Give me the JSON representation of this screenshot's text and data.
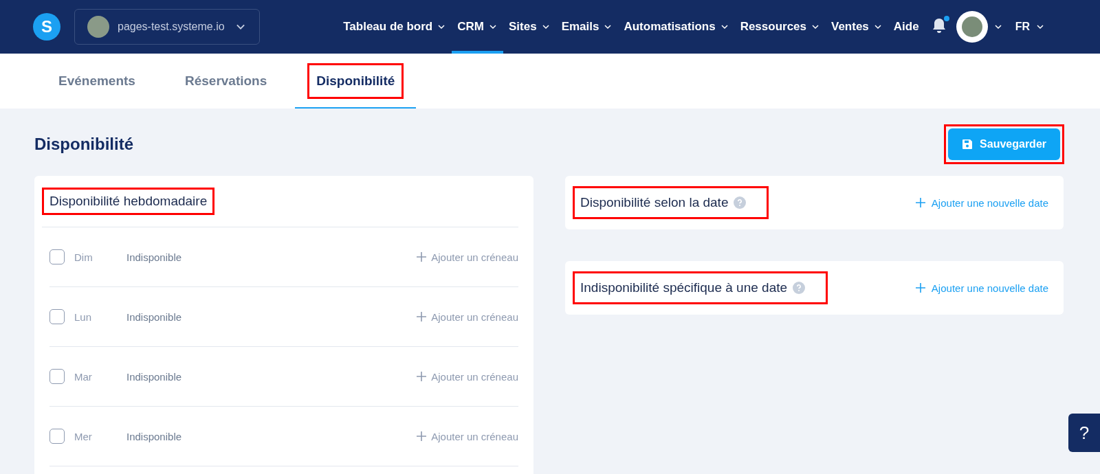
{
  "header": {
    "logo": "S",
    "site_selector": "pages-test.systeme.io",
    "nav": [
      {
        "label": "Tableau de bord",
        "dropdown": true,
        "selected": false
      },
      {
        "label": "CRM",
        "dropdown": true,
        "selected": true
      },
      {
        "label": "Sites",
        "dropdown": true,
        "selected": false
      },
      {
        "label": "Emails",
        "dropdown": true,
        "selected": false
      },
      {
        "label": "Automatisations",
        "dropdown": true,
        "selected": false
      },
      {
        "label": "Ressources",
        "dropdown": true,
        "selected": false
      },
      {
        "label": "Ventes",
        "dropdown": true,
        "selected": false
      },
      {
        "label": "Aide",
        "dropdown": false,
        "selected": false
      }
    ],
    "notification_dot": true,
    "language": "FR"
  },
  "tabs": [
    {
      "label": "Evénements",
      "selected": false,
      "highlighted": false
    },
    {
      "label": "Réservations",
      "selected": false,
      "highlighted": false
    },
    {
      "label": "Disponibilité",
      "selected": true,
      "highlighted": true
    }
  ],
  "page": {
    "title": "Disponibilité",
    "save_button": {
      "label": "Sauvegarder",
      "highlighted": true
    }
  },
  "weekly": {
    "title": "Disponibilité hebdomadaire",
    "highlighted": true,
    "days": [
      {
        "day": "Dim",
        "status": "Indisponible",
        "checked": false,
        "action": "Ajouter un créneau"
      },
      {
        "day": "Lun",
        "status": "Indisponible",
        "checked": false,
        "action": "Ajouter un créneau"
      },
      {
        "day": "Mar",
        "status": "Indisponible",
        "checked": false,
        "action": "Ajouter un créneau"
      },
      {
        "day": "Mer",
        "status": "Indisponible",
        "checked": false,
        "action": "Ajouter un créneau"
      }
    ]
  },
  "date_cards": [
    {
      "title": "Disponibilité selon la date",
      "highlighted": true,
      "action": "Ajouter une nouvelle date"
    },
    {
      "title": "Indisponibilité spécifique à une date",
      "highlighted": true,
      "action": "Ajouter une nouvelle date"
    }
  ],
  "help_button": "?"
}
